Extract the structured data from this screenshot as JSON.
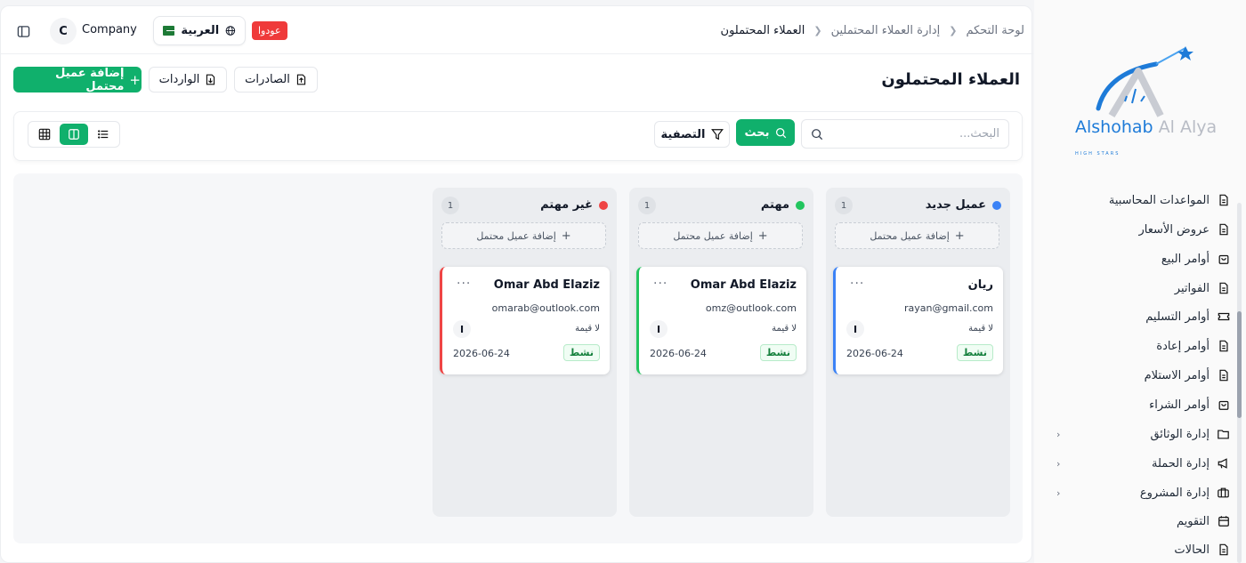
{
  "brand": {
    "name_main": "Alshohab",
    "name_light": "Al Alya",
    "tagline": "HIGH STARS",
    "accent_color": "#1e7bd8"
  },
  "sidebar": {
    "items": [
      {
        "label": "المواعدات المحاسبية",
        "icon": "file-icon",
        "expandable": false
      },
      {
        "label": "عروض الأسعار",
        "icon": "file-icon",
        "expandable": false
      },
      {
        "label": "أوامر البيع",
        "icon": "bag-icon",
        "expandable": false
      },
      {
        "label": "الفواتير",
        "icon": "file-icon",
        "expandable": false
      },
      {
        "label": "أوامر التسليم",
        "icon": "ticket-icon",
        "expandable": false
      },
      {
        "label": "أوامر إعادة",
        "icon": "file-icon",
        "expandable": false
      },
      {
        "label": "أوامر الاستلام",
        "icon": "file-icon",
        "expandable": false
      },
      {
        "label": "أوامر الشراء",
        "icon": "bag-icon",
        "expandable": false
      },
      {
        "label": "إدارة الوثائق",
        "icon": "folder-icon",
        "expandable": true
      },
      {
        "label": "إدارة الحملة",
        "icon": "megaphone-icon",
        "expandable": true
      },
      {
        "label": "إدارة المشروع",
        "icon": "briefcase-icon",
        "expandable": true
      },
      {
        "label": "التقويم",
        "icon": "calendar-icon",
        "expandable": false
      },
      {
        "label": "الحالات",
        "icon": "file-icon",
        "expandable": false
      }
    ]
  },
  "topbar": {
    "company_initial": "C",
    "company_name": "Company",
    "language": "العربية",
    "odoo_badge": "عودوا",
    "breadcrumb": [
      "لوحة التحكم",
      "إدارة العملاء المحتملين",
      "العملاء المحتملون"
    ]
  },
  "page": {
    "title": "العملاء المحتملون",
    "add_button": "إضافة عميل محتمل",
    "import_button": "الواردات",
    "export_button": "الصادرات"
  },
  "toolbar": {
    "search_placeholder": "البحث...",
    "search_button": "بحث",
    "filter_button": "التصفية"
  },
  "board": {
    "add_label": "إضافة عميل محتمل",
    "columns": [
      {
        "title": "عميل جديد",
        "count": "1",
        "color": "#3b82f6",
        "card": {
          "name": "ريان",
          "email": "rayan@gmail.com",
          "value": "لا قيمة",
          "initial": "I",
          "status": "نشط",
          "date": "2026-06-24"
        }
      },
      {
        "title": "مهتم",
        "count": "1",
        "color": "#22c55e",
        "card": {
          "name": "Omar Abd Elaziz",
          "email": "omz@outlook.com",
          "value": "لا قيمة",
          "initial": "I",
          "status": "نشط",
          "date": "2026-06-24"
        }
      },
      {
        "title": "غير مهتم",
        "count": "1",
        "color": "#ef4444",
        "card": {
          "name": "Omar Abd Elaziz",
          "email": "omarab@outlook.com",
          "value": "لا قيمة",
          "initial": "I",
          "status": "نشط",
          "date": "2026-06-24"
        }
      }
    ]
  }
}
